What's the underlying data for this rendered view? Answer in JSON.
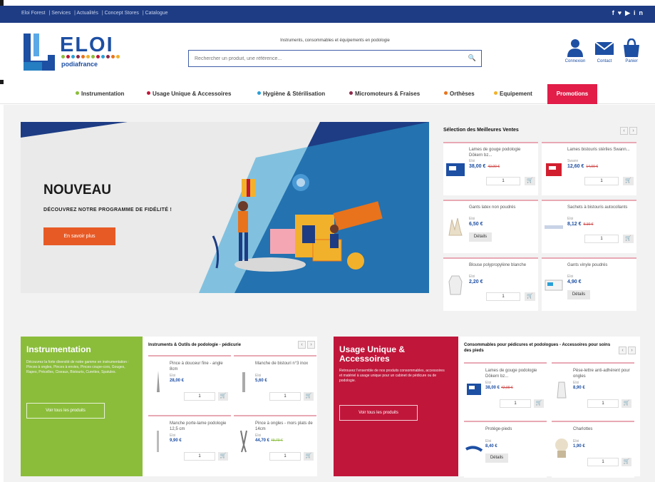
{
  "topbar": {
    "links": [
      "Eloi Forest",
      "Services",
      "Actualités",
      "Concept Stores",
      "Catalogue"
    ],
    "social": [
      "f",
      "t",
      "yt",
      "in"
    ]
  },
  "header": {
    "logo_word": "ELOI",
    "logo_sub": "podiafrance",
    "tagline": "Instruments, consommables et équipements en podologie",
    "search_placeholder": "Rechercher un produit, une référence...",
    "icons": [
      {
        "label": "Connexion",
        "icon": "user-icon"
      },
      {
        "label": "Contact",
        "icon": "envelope-icon"
      },
      {
        "label": "Panier",
        "icon": "bag-icon"
      }
    ]
  },
  "nav": {
    "items": [
      {
        "label": "Instrumentation",
        "color": "#8bbd3b"
      },
      {
        "label": "Usage Unique & Accessoires",
        "color": "#c0163a"
      },
      {
        "label": "Hygiène & Stérilisation",
        "color": "#2a9fd6"
      },
      {
        "label": "Micromoteurs & Fraises",
        "color": "#8c2a4a"
      },
      {
        "label": "Orthèses",
        "color": "#e8731c"
      },
      {
        "label": "Equipement",
        "color": "#f2b12a"
      }
    ],
    "promo": "Promotions"
  },
  "hero": {
    "title": "NOUVEAU",
    "subtitle": "DÉCOUVREZ NOTRE PROGRAMME DE FIDÉLITÉ !",
    "button": "En savoir plus"
  },
  "bestsellers": {
    "title": "Sélection des Meilleures Ventes",
    "products": [
      {
        "name": "Lames de gouge podologie Dökern bz...",
        "brand": "Eloi",
        "price": "38,00 €",
        "old": "42,00 €",
        "qty": "1",
        "thumb": "blade-box"
      },
      {
        "name": "Lames bistouris stériles Swann...",
        "brand": "Swann",
        "price": "12,60 €",
        "old": "14,00 €",
        "qty": "1",
        "thumb": "red-box"
      },
      {
        "name": "Gants latex non poudrés",
        "brand": "Eloi",
        "price": "6,50 €",
        "old": "",
        "qty": "",
        "details": "Détails",
        "thumb": "glove"
      },
      {
        "name": "Sachets à bistouris autocollants",
        "brand": "Eloi",
        "price": "8,12 €",
        "old": "9,10 €",
        "qty": "1",
        "thumb": "pouch"
      },
      {
        "name": "Blouse polypropylène blanche",
        "brand": "Eloi",
        "price": "2,20 €",
        "old": "",
        "qty": "1",
        "thumb": "gown"
      },
      {
        "name": "Gants vinyle poudrés",
        "brand": "Eloi",
        "price": "4,90 €",
        "old": "",
        "qty": "",
        "details": "Détails",
        "thumb": "box"
      }
    ]
  },
  "instrumentation": {
    "title": "Instrumentation",
    "description": "Découvrez la forte diversité de notre gamme en instrumentation : Pinces à ongles, Pinces à envies, Pinces coupe-cors, Gouges, Rapes, Précelles, Ciseaux, Bistouris, Curettes, Spatules.",
    "button": "Voir tous les produits",
    "color": "#8bbd3b",
    "box_title": "Instruments & Outils de podologie - pédicurie",
    "products": [
      {
        "name": "Pince à douceur fine - angle 8cm",
        "brand": "Eloi",
        "price": "28,00 €",
        "old": "",
        "qty": "1"
      },
      {
        "name": "Manche de bistouri n°3 inox",
        "brand": "Eloi",
        "price": "5,60 €",
        "old": "",
        "qty": "1"
      },
      {
        "name": "Manche porte-lame podologie 12,5 cm",
        "brand": "Eloi",
        "price": "9,90 €",
        "old": "",
        "qty": "1"
      },
      {
        "name": "Pince à ongles - mors plats de 14cm",
        "brand": "Eloi",
        "price": "44,70 €",
        "old": "49,70 €",
        "qty": "1"
      }
    ]
  },
  "usage_unique": {
    "title": "Usage Unique & Accessoires",
    "description": "Retrouvez l'ensemble de nos produits consommables, accessoires et matériel à usage unique pour un cabinet de pédicure ou de podologie.",
    "button": "Voir tous les produits",
    "color": "#c0163a",
    "box_title": "Consommables pour pédicures et podologues - Accessoires pour soins des pieds",
    "products": [
      {
        "name": "Lames de gouge podologie Dökern bz...",
        "brand": "Eloi",
        "price": "38,00 €",
        "old": "42,00 €",
        "qty": "1"
      },
      {
        "name": "Pèse-lettre anti-adhérent pour ongles",
        "brand": "Eloi",
        "price": "8,90 €",
        "old": "",
        "qty": "1"
      },
      {
        "name": "Protège-pieds",
        "brand": "Eloi",
        "price": "8,40 €",
        "old": "",
        "qty": "",
        "details": "Détails"
      },
      {
        "name": "Charlottes",
        "brand": "Eloi",
        "price": "1,90 €",
        "old": "",
        "qty": "1"
      }
    ]
  }
}
